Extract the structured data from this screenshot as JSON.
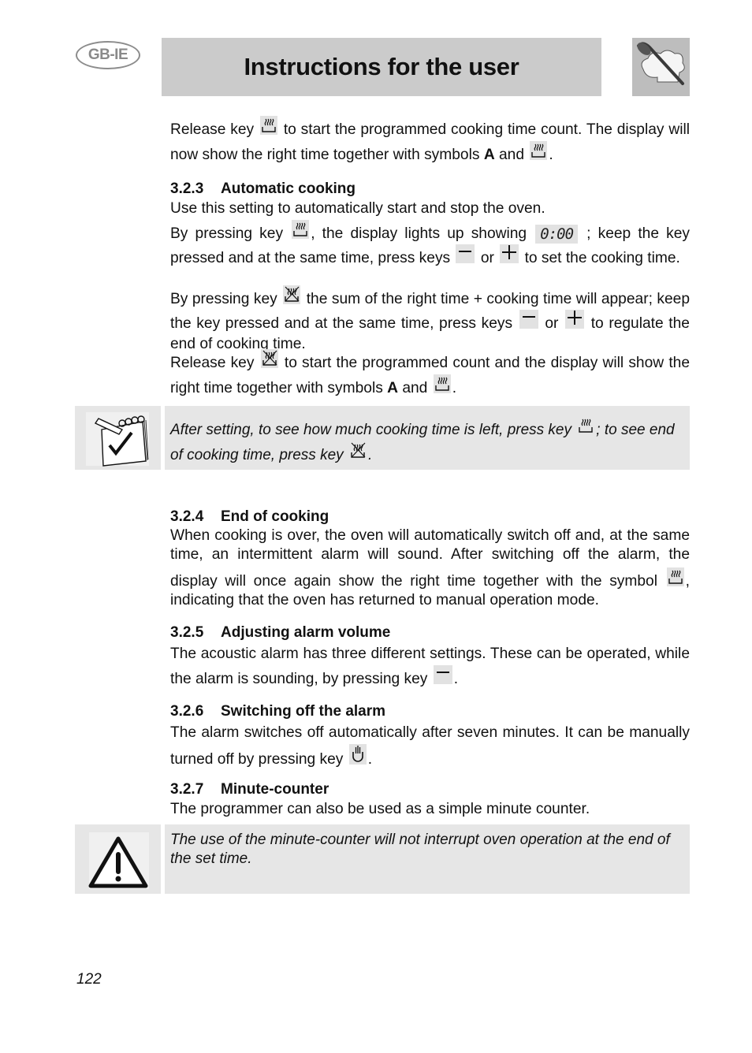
{
  "header": {
    "region_badge": "GB-IE",
    "title": "Instructions for the user",
    "logo_icon": "chef-hat-spoon-icon"
  },
  "intro": {
    "p1_a": "Release key",
    "p1_b": "to start the programmed cooking time count. The display will now show the right time together with symbols",
    "p1_sym": "A",
    "p1_c": "and",
    "p1_end": "."
  },
  "sections": {
    "s323": {
      "number": "3.2.3",
      "title": "Automatic cooking",
      "line1": "Use this setting to automatically start and stop the oven.",
      "p2_a": "By pressing key",
      "p2_b": ", the display lights up showing",
      "display_value": "0:00",
      "p2_c": "; keep the key pressed and at the same time, press keys",
      "p2_or": "or",
      "p2_d": "to set the cooking time.",
      "p3_a": "By pressing key",
      "p3_b": "the sum of the right time + cooking time will appear; keep the key pressed and at the same time, press keys",
      "p3_or": "or",
      "p3_c": "to regulate the end of cooking time.",
      "p4_a": "Release key",
      "p4_b": "to start the programmed count and the display will show the right time together with symbols",
      "p4_sym": "A",
      "p4_c": "and",
      "p4_end": "."
    },
    "note1": {
      "icon": "notepad-check-icon",
      "a": "After setting, to see how much cooking time is left, press key",
      "b": "; to see end of cooking time, press key",
      "end": "."
    },
    "s324": {
      "number": "3.2.4",
      "title": "End of cooking",
      "a": "When cooking is over, the oven will automatically switch off and, at the same time, an intermittent alarm will sound. After switching off the alarm, the display will once again show the right time together with the symbol",
      "b": ", indicating that the oven has returned to manual operation mode."
    },
    "s325": {
      "number": "3.2.5",
      "title": "Adjusting alarm volume",
      "a": "The acoustic alarm has three different settings. These can be operated, while the alarm is sounding, by pressing key",
      "end": "."
    },
    "s326": {
      "number": "3.2.6",
      "title": "Switching off the alarm",
      "a": "The alarm switches off automatically after seven minutes. It can be manually turned off by pressing key",
      "end": "."
    },
    "s327": {
      "number": "3.2.7",
      "title": "Minute-counter",
      "text": "The programmer can also be used as a simple minute counter."
    },
    "warning": {
      "icon": "warning-triangle-icon",
      "text": "The use of the minute-counter will not interrupt oven operation at the end of the set time."
    }
  },
  "footer": {
    "page_number": "122"
  }
}
